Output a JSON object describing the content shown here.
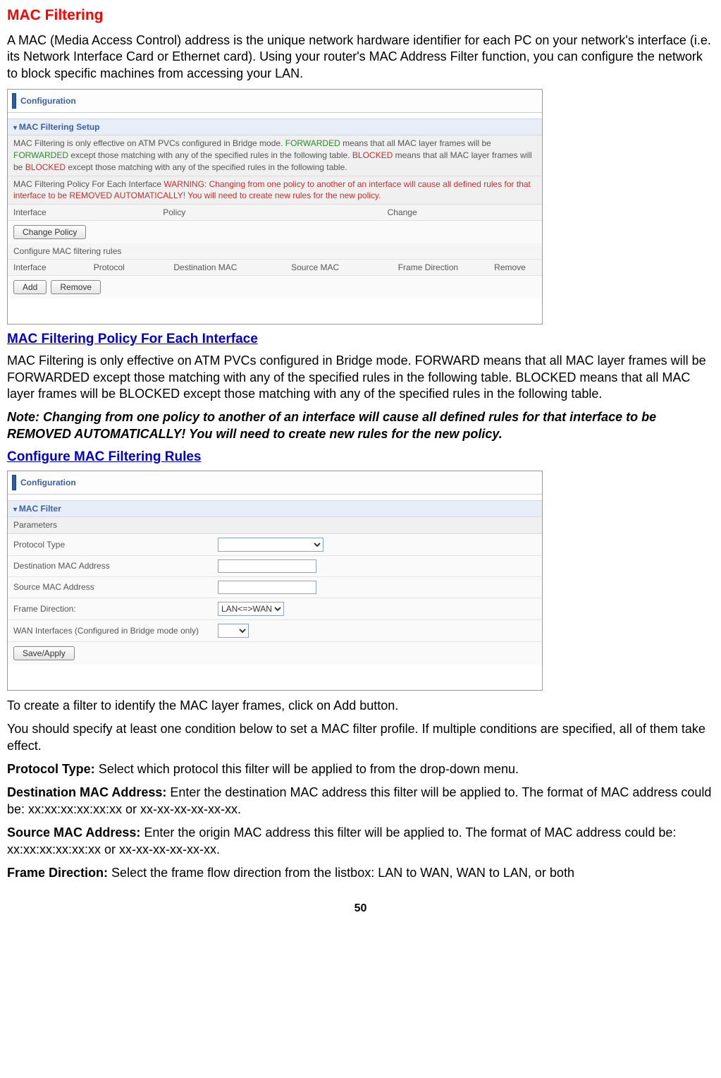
{
  "title": "MAC Filtering",
  "intro": "A MAC (Media Access Control) address is the unique network hardware identifier for each PC on your network's interface (i.e. its Network Interface Card or Ethernet card). Using your router's MAC Address Filter function, you can configure the network to block specific machines from accessing your LAN.",
  "ss1": {
    "config": "Configuration",
    "panel": "MAC Filtering Setup",
    "desc1_a": "MAC Filtering is only effective on ATM PVCs configured in Bridge mode. ",
    "desc1_b": "FORWARDED",
    "desc1_c": " means that all MAC layer frames will be ",
    "desc1_d": "FORWARDED",
    "desc1_e": " except those matching with any of the specified rules in the following table. ",
    "desc1_f": "BLOCKED",
    "desc1_g": " means that all MAC layer frames will be ",
    "desc1_h": "BLOCKED",
    "desc1_i": " except those matching with any of the specified rules in the following table.",
    "desc2_a": "MAC Filtering Policy For Each Interface ",
    "desc2_b": "WARNING: Changing from one policy to another of an interface will cause all defined rules for that interface to be REMOVED AUTOMATICALLY! You will need to create new rules for the new policy.",
    "cols1": {
      "c1": "Interface",
      "c2": "Policy",
      "c3": "Change"
    },
    "change_policy_btn": "Change Policy",
    "configure_label": "Configure MAC filtering rules",
    "cols2": {
      "c1": "Interface",
      "c2": "Protocol",
      "c3": "Destination MAC",
      "c4": "Source MAC",
      "c5": "Frame Direction",
      "c6": "Remove"
    },
    "add_btn": "Add",
    "remove_btn": "Remove"
  },
  "subhead1": "MAC Filtering Policy For Each Interface",
  "policy_text": "MAC Filtering is only effective on ATM PVCs configured in Bridge mode. FORWARD means that all MAC layer frames will be FORWARDED except those matching with any of the specified rules in the following table. BLOCKED means that all MAC layer frames will be BLOCKED except those matching with any of the specified rules in the following table.",
  "note_text": "Note: Changing from one policy to another of an interface will cause all defined rules for that interface to be REMOVED AUTOMATICALLY! You will need to create new rules for the new policy.",
  "subhead2": "Configure MAC Filtering Rules",
  "ss2": {
    "config": "Configuration",
    "panel": "MAC Filter",
    "parameters": "Parameters",
    "rows": {
      "protocol": "Protocol Type",
      "dest": "Destination MAC Address",
      "src": "Source MAC Address",
      "frame": "Frame Direction:",
      "wan": "WAN Interfaces (Configured in Bridge mode only)"
    },
    "frame_value": "LAN<=>WAN",
    "save_btn": "Save/Apply"
  },
  "after_ss2_a": "To create a filter to identify the MAC layer frames, click on Add button.",
  "after_ss2_b": "You should specify at least one condition below to set a MAC filter profile. If multiple conditions are specified, all of them take effect.",
  "pt_label": "Protocol Type: ",
  "pt_text": "Select which protocol this filter will be applied to from the drop-down menu.",
  "dm_label": "Destination MAC Address: ",
  "dm_text": "Enter the destination MAC address this filter will be applied to. The format of MAC address could be: xx:xx:xx:xx:xx:xx or xx-xx-xx-xx-xx-xx.",
  "sm_label": "Source MAC Address: ",
  "sm_text": "Enter the origin MAC address this filter will be applied to. The format of MAC address could be: xx:xx:xx:xx:xx:xx or xx-xx-xx-xx-xx-xx.",
  "fd_label": "Frame Direction: ",
  "fd_text": "Select the frame flow direction from the listbox: LAN to WAN, WAN to LAN, or both",
  "page_num": "50"
}
